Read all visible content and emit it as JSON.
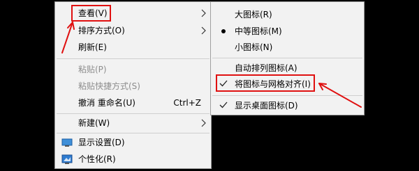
{
  "main_menu": {
    "items": [
      {
        "label": "查看(V)",
        "has_submenu": true,
        "enabled": true
      },
      {
        "label": "排序方式(O)",
        "has_submenu": true,
        "enabled": true
      },
      {
        "label": "刷新(E)",
        "enabled": true
      },
      {
        "label": "粘贴(P)",
        "enabled": false
      },
      {
        "label": "粘贴快捷方式(S)",
        "enabled": false
      },
      {
        "label": "撤消 重命名(U)",
        "shortcut": "Ctrl+Z",
        "enabled": true
      },
      {
        "label": "新建(W)",
        "has_submenu": true,
        "enabled": true
      },
      {
        "label": "显示设置(D)",
        "icon": "display-icon",
        "enabled": true
      },
      {
        "label": "个性化(R)",
        "icon": "personalize-icon",
        "enabled": true
      }
    ]
  },
  "sub_menu": {
    "items": [
      {
        "label": "大图标(R)"
      },
      {
        "label": "中等图标(M)",
        "selected": true
      },
      {
        "label": "小图标(N)"
      },
      {
        "label": "自动排列图标(A)"
      },
      {
        "label": "将图标与网格对齐(I)",
        "checked": true
      },
      {
        "label": "显示桌面图标(D)",
        "checked": true
      }
    ]
  },
  "colors": {
    "highlight": "#e01010",
    "menu_bg": "#f2f2f2",
    "disabled": "#8d8d8d"
  }
}
